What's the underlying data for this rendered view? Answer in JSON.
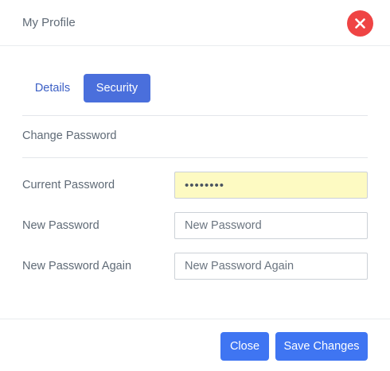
{
  "header": {
    "title": "My Profile",
    "close_icon": "close-icon"
  },
  "tabs": [
    {
      "label": "Details",
      "active": false
    },
    {
      "label": "Security",
      "active": true
    }
  ],
  "section": {
    "title": "Change Password"
  },
  "form": {
    "current_password": {
      "label": "Current Password",
      "value": "••••••••",
      "placeholder": ""
    },
    "new_password": {
      "label": "New Password",
      "value": "",
      "placeholder": "New Password"
    },
    "new_password_again": {
      "label": "New Password Again",
      "value": "",
      "placeholder": "New Password Again"
    }
  },
  "footer": {
    "close_label": "Close",
    "save_label": "Save Changes"
  },
  "colors": {
    "accent": "#4a6fdc",
    "button": "#3f75f2",
    "danger": "#ef4444",
    "autofill": "#fdfac2"
  }
}
